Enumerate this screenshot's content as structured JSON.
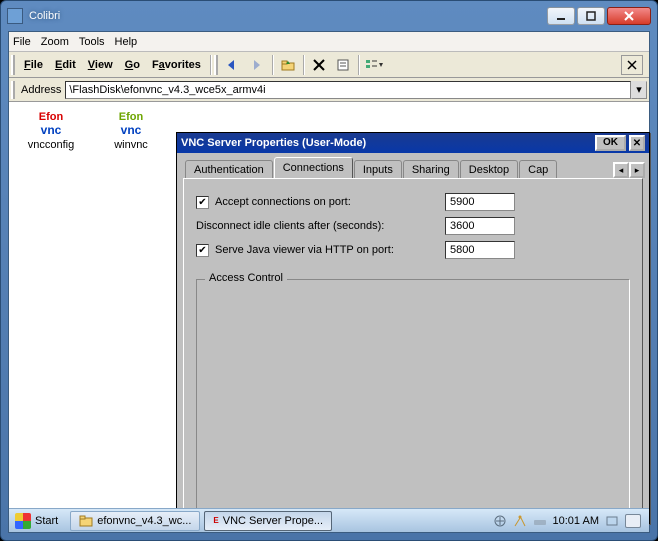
{
  "outer": {
    "title": "Colibri"
  },
  "menubar": {
    "file": "File",
    "zoom": "Zoom",
    "tools": "Tools",
    "help": "Help"
  },
  "explorer_menu": {
    "file": "File",
    "edit": "Edit",
    "view": "View",
    "go": "Go",
    "favorites": "Favorites"
  },
  "address": {
    "label": "Address",
    "value": "\\FlashDisk\\efonvnc_v4.3_wce5x_armv4i"
  },
  "icons": {
    "vncconfig": {
      "brand_top_a": "Efon",
      "brand_bottom": "vnc",
      "label": "vncconfig"
    },
    "winvnc": {
      "brand_top_a": "Efon",
      "brand_bottom": "vnc",
      "label": "winvnc"
    }
  },
  "dialog": {
    "title": "VNC Server Properties (User-Mode)",
    "ok": "OK",
    "tabs": {
      "auth": "Authentication",
      "conn": "Connections",
      "inputs": "Inputs",
      "sharing": "Sharing",
      "desktop": "Desktop",
      "cap": "Cap"
    },
    "conn": {
      "accept_label": "Accept connections on port:",
      "accept_port": "5900",
      "idle_label": "Disconnect idle clients after (seconds):",
      "idle_value": "3600",
      "java_label": "Serve Java viewer via HTTP on port:",
      "java_port": "5800",
      "access_control": "Access Control"
    }
  },
  "taskbar": {
    "start": "Start",
    "task1": "efonvnc_v4.3_wc...",
    "task2": "VNC Server Prope...",
    "clock": "10:01 AM"
  }
}
